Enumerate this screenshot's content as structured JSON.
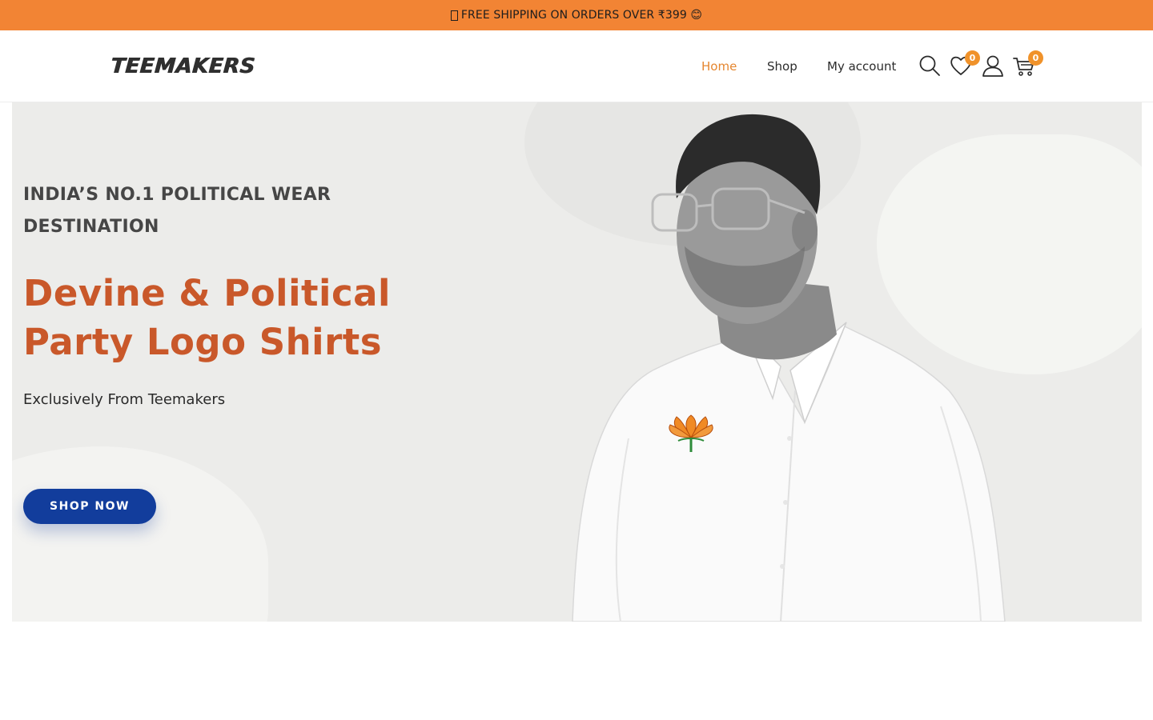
{
  "promo": {
    "text": "FREE SHIPPING ON ORDERS OVER ₹399 😊"
  },
  "header": {
    "logo": "TEEMAKERS",
    "nav": [
      {
        "label": "Home",
        "active": true
      },
      {
        "label": "Shop",
        "active": false
      },
      {
        "label": "My account",
        "active": false
      }
    ],
    "icons": {
      "search": "search-icon",
      "wishlist": "heart-icon",
      "account": "user-icon",
      "cart": "cart-icon"
    },
    "wishlist_count": "0",
    "cart_count": "0"
  },
  "hero": {
    "eyebrow": "INDIA’S NO.1 POLITICAL WEAR DESTINATION",
    "headline": "Devine & Political Party Logo Shirts",
    "subline": "Exclusively From Teemakers",
    "cta": "SHOP NOW"
  },
  "colors": {
    "promo_bg": "#f28434",
    "accent": "#e5862f",
    "headline": "#c9582a",
    "cta_bg": "#123d9c",
    "badge": "#f0922a"
  }
}
